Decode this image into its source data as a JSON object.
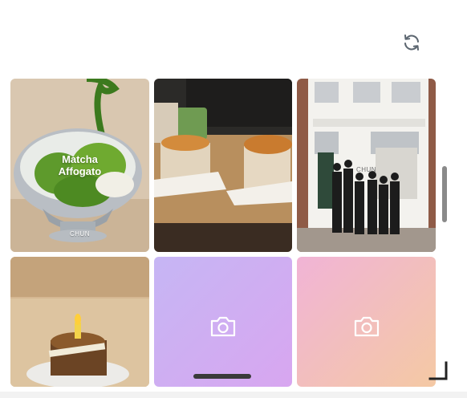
{
  "toolbar": {
    "refresh_icon": "refresh-icon"
  },
  "tiles": [
    {
      "kind": "photo",
      "subject": "matcha-affogato",
      "title": "Matcha\nAffogato",
      "brand": "CHUN"
    },
    {
      "kind": "photo",
      "subject": "sandwiches-and-matcha"
    },
    {
      "kind": "photo",
      "subject": "storefront-staff",
      "brand": "CHUN"
    },
    {
      "kind": "photo",
      "subject": "birthday-cake"
    },
    {
      "kind": "placeholder",
      "icon": "camera-icon",
      "gradient": [
        "#c6b6f4",
        "#d8a6f0"
      ]
    },
    {
      "kind": "placeholder",
      "icon": "camera-icon",
      "gradient": [
        "#f1b4d6",
        "#f4c9a4"
      ]
    }
  ],
  "colors": {
    "scrollbar": "#8a8a8a",
    "home_indicator": "#3a3a3a"
  }
}
